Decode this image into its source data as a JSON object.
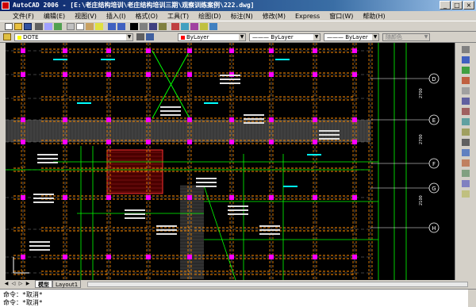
{
  "window": {
    "title": "AutoCAD 2006 - [E:\\老庄结构培训\\老庄结构培训三期\\观察训练案例\\222.dwg]",
    "min": "_",
    "max": "□",
    "close": "×"
  },
  "menu": [
    "文件(F)",
    "编辑(E)",
    "视图(V)",
    "插入(I)",
    "格式(O)",
    "工具(T)",
    "绘图(D)",
    "标注(N)",
    "修改(M)",
    "Express",
    "窗口(W)",
    "帮助(H)"
  ],
  "toolbar": {
    "layer": "DOTE",
    "color": "ByLayer",
    "linetype": "ByLayer",
    "lineweight": "ByLayer",
    "plotstyle": "随颜色"
  },
  "tabs": {
    "model": "模型",
    "layout": "Layout1"
  },
  "command": {
    "line1": "命令：*取消*",
    "line2": "命令：*取消*"
  },
  "drawing": {
    "axis_labels": [
      "D",
      "E",
      "F",
      "G",
      "H"
    ],
    "dims": [
      "2700",
      "2700",
      "2100"
    ]
  }
}
